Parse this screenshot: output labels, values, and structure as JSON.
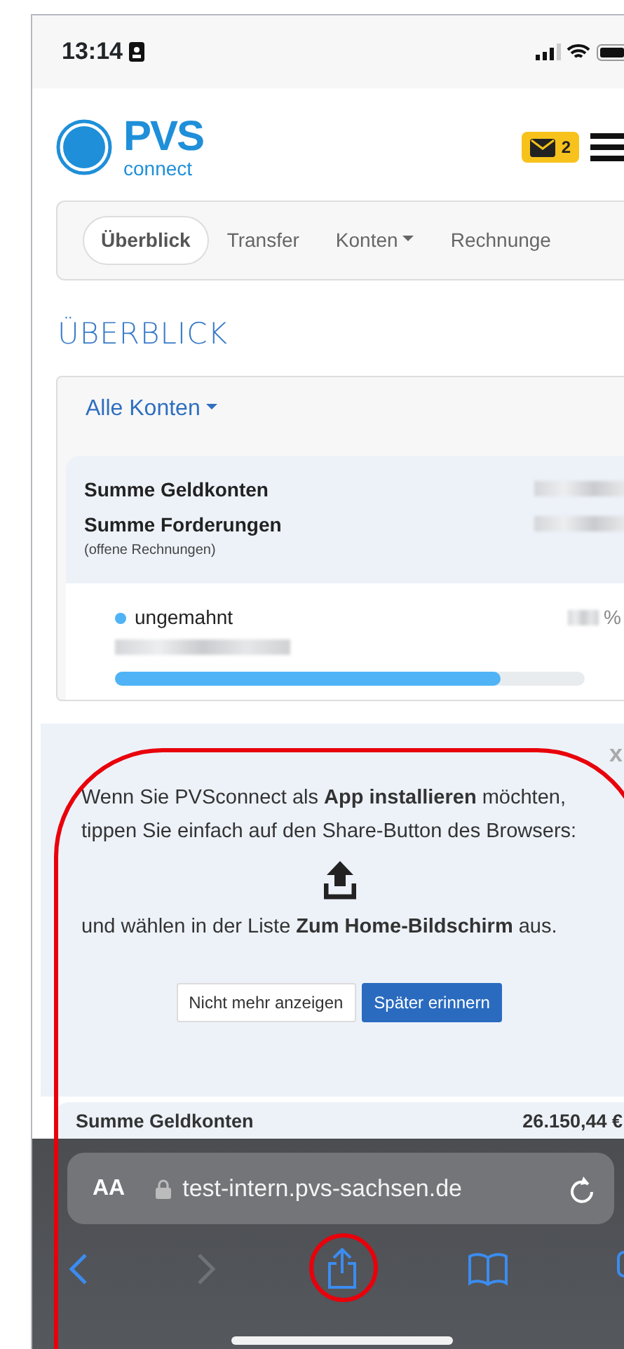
{
  "status_bar": {
    "time": "13:14"
  },
  "header": {
    "logo_title": "PVS",
    "logo_subtitle": "connect",
    "messages_count": "2"
  },
  "nav": {
    "items": [
      {
        "label": "Überblick",
        "selected": true,
        "dropdown": false
      },
      {
        "label": "Transfer",
        "selected": false,
        "dropdown": false
      },
      {
        "label": "Konten",
        "selected": false,
        "dropdown": true
      },
      {
        "label": "Rechnunge",
        "selected": false,
        "dropdown": false
      }
    ]
  },
  "page_title": "ÜBERBLICK",
  "accounts_card": {
    "filter": "Alle Konten",
    "summary": [
      {
        "label": "Summe Geldkonten"
      },
      {
        "label": "Summe Forderungen",
        "note": "(offene Rechnungen)"
      }
    ],
    "status": [
      {
        "label": "ungemahnt",
        "color": "#4fb3f6",
        "unit": "%",
        "level": 0.82
      }
    ]
  },
  "install_prompt": {
    "close": "x",
    "message": "Wenn Sie PVSconnect als **App installieren** möchten, tippen Sie einfach auf den Share-Button des Browsers:",
    "instruction": "und wählen in der Liste **Zum Home-Bildschirm** aus.",
    "buttons": [
      {
        "label": "Nicht mehr anzeigen",
        "kind": "secondary"
      },
      {
        "label": "Später erinnern",
        "kind": "primary"
      }
    ]
  },
  "background_card": {
    "label": "Summe Geldkonten",
    "value": "26.150,44 €"
  },
  "browser": {
    "text_size": "AA",
    "url": "test-intern.pvs-sachsen.de",
    "back_enabled": true,
    "forward_enabled": false
  }
}
